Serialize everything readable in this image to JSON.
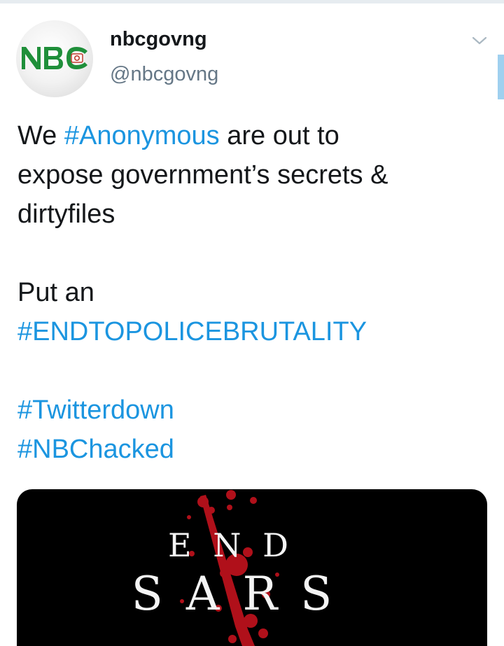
{
  "tweet": {
    "display_name": "nbcgovng",
    "handle": "@nbcgovng",
    "avatar_logo_text": "NBC",
    "text": {
      "line1_pre": "We ",
      "line1_hashtag": "#Anonymous",
      "line1_post": " are out to",
      "line2": "expose government’s secrets &",
      "line3": "dirtyfiles",
      "line4": "Put an",
      "hashtag_endpolice": "#ENDTOPOLICEBRUTALITY",
      "hashtag_twitterdown": "#Twitterdown",
      "hashtag_nbchacked": "#NBChacked"
    },
    "media": {
      "line1": "E N D",
      "line2": "S A R S"
    }
  },
  "colors": {
    "hashtag": "#1b95e0",
    "text": "#14171a",
    "handle": "#657786",
    "logo_green": "#1f8f3a",
    "blood_red": "#b0101a"
  },
  "icons": {
    "caret": "chevron-down-icon"
  }
}
